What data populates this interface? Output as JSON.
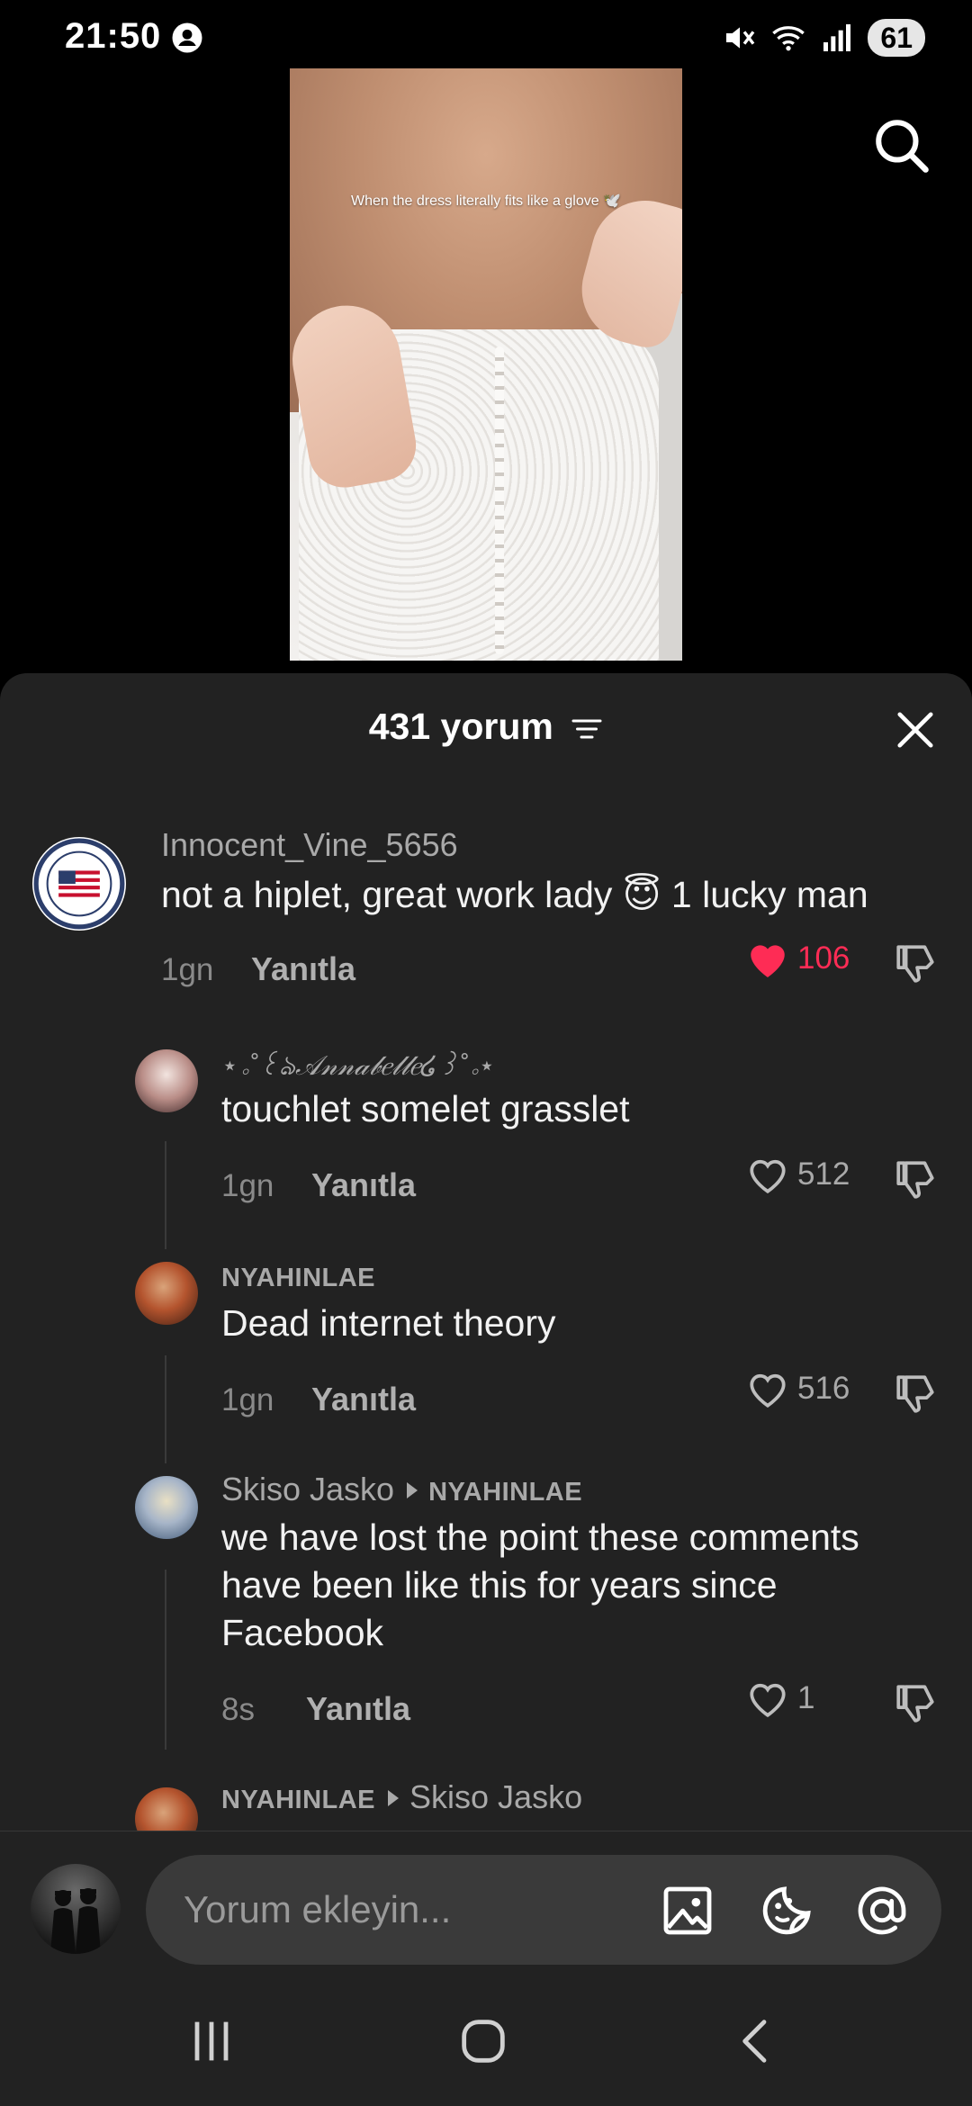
{
  "status_bar": {
    "time": "21:50",
    "battery": "61",
    "icons": [
      "account-circle-icon",
      "mute-icon",
      "wifi-icon",
      "signal-icon"
    ]
  },
  "video": {
    "caption": "When the dress literally fits like a glove 🕊️"
  },
  "comments_sheet": {
    "title": "431 yorum",
    "comments": [
      {
        "user": "Innocent_Vine_5656",
        "text": "not a hiplet, great work lady 😇 1 lucky man",
        "age": "1gn",
        "reply_label": "Yanıtla",
        "likes": "106",
        "liked": true
      },
      {
        "user": "⋆｡˚꒰ঌ𝒜𝓃𝓃𝒶𝒷𝑒𝓁𝓁𝑒໒꒱˚｡⋆",
        "text": "touchlet somelet grasslet",
        "age": "1gn",
        "reply_label": "Yanıtla",
        "likes": "512",
        "liked": false
      },
      {
        "user": "NYAHINLAE",
        "text": "Dead internet theory",
        "age": "1gn",
        "reply_label": "Yanıtla",
        "likes": "516",
        "liked": false
      },
      {
        "user": "Skiso Jasko",
        "reply_to": "NYAHINLAE",
        "text": "we have lost the point these comments have been like this for years since Facebook",
        "age": "8s",
        "reply_label": "Yanıtla",
        "likes": "1",
        "liked": false
      },
      {
        "user": "NYAHINLAE",
        "reply_to": "Skiso Jasko"
      }
    ]
  },
  "input": {
    "placeholder": "Yorum ekleyin..."
  },
  "colors": {
    "sheet_bg": "#222222",
    "like_red": "#fe2c55",
    "muted_text": "#a9a9a9"
  }
}
